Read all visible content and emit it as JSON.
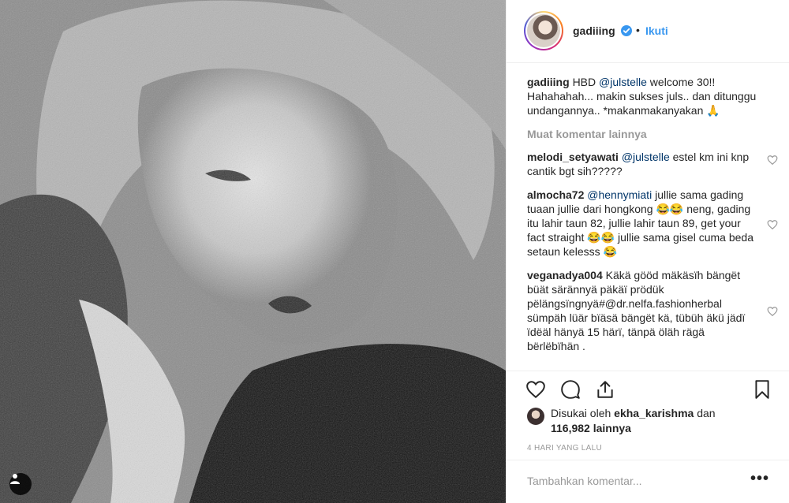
{
  "post": {
    "username": "gadiiing",
    "follow_label": "Ikuti",
    "separator": "•",
    "caption": {
      "user": "gadiiing",
      "pre": "HBD ",
      "mention": "@julstelle",
      "post": " welcome 30!! Hahahahah... makin sukses juls.. dan ditunggu undangannya.. *makanmakanyakan 🙏"
    },
    "load_more": "Muat komentar lainnya",
    "comments": [
      {
        "user": "melodi_setyawati",
        "mention": "@julstelle",
        "text": " estel km ini knp cantik bgt sih?????"
      },
      {
        "user": "almocha72",
        "mention": "@hennymiati",
        "text": " jullie sama gading tuaan jullie dari hongkong 😂😂 neng, gading itu lahir taun 82, jullie lahir taun 89, get your fact straight 😂😂 jullie sama gisel cuma beda setaun kelesss 😂"
      },
      {
        "user": "veganadya004",
        "mention": "",
        "text": " Käkä gööd mäkäsïh bängët büät särännyä päkäï prödük pëlängsïngnyä#@dr.nelfa.fashionherbal sümpäh lüär bïäsä bängët kä, tübüh äkü jädï ïdëäl hänyä 15 härï, tänpä öläh rägä bërlëbïhän ."
      }
    ],
    "likes": {
      "prefix": "Disukai oleh ",
      "user": "ekha_karishma",
      "middle": " dan ",
      "count": "116,982 lainnya"
    },
    "timestamp": "4 HARI YANG LALU",
    "add_comment_placeholder": "Tambahkan komentar...",
    "more_options": "•••"
  },
  "icons": [
    "user-tag-icon",
    "verified-icon",
    "like-icon",
    "comment-icon",
    "share-icon",
    "save-icon",
    "small-heart-icon"
  ],
  "colors": {
    "link": "#3897f0",
    "mention": "#003569",
    "muted": "#999999",
    "text": "#262626"
  }
}
